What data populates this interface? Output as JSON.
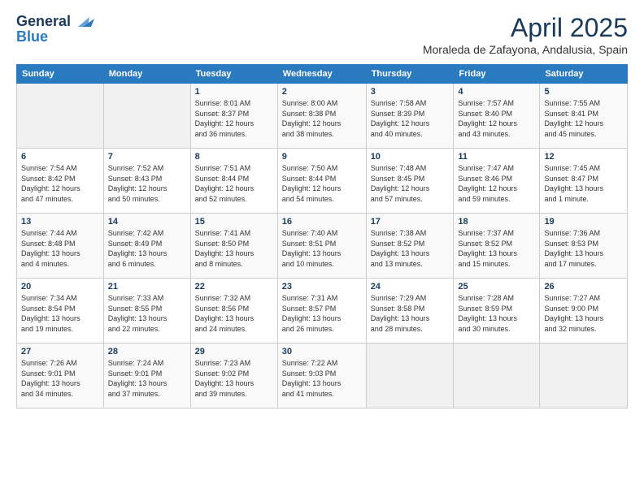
{
  "header": {
    "logo_line1": "General",
    "logo_line2": "Blue",
    "month_title": "April 2025",
    "subtitle": "Moraleda de Zafayona, Andalusia, Spain"
  },
  "days_of_week": [
    "Sunday",
    "Monday",
    "Tuesday",
    "Wednesday",
    "Thursday",
    "Friday",
    "Saturday"
  ],
  "weeks": [
    [
      {
        "num": "",
        "info": ""
      },
      {
        "num": "",
        "info": ""
      },
      {
        "num": "1",
        "info": "Sunrise: 8:01 AM\nSunset: 8:37 PM\nDaylight: 12 hours\nand 36 minutes."
      },
      {
        "num": "2",
        "info": "Sunrise: 8:00 AM\nSunset: 8:38 PM\nDaylight: 12 hours\nand 38 minutes."
      },
      {
        "num": "3",
        "info": "Sunrise: 7:58 AM\nSunset: 8:39 PM\nDaylight: 12 hours\nand 40 minutes."
      },
      {
        "num": "4",
        "info": "Sunrise: 7:57 AM\nSunset: 8:40 PM\nDaylight: 12 hours\nand 43 minutes."
      },
      {
        "num": "5",
        "info": "Sunrise: 7:55 AM\nSunset: 8:41 PM\nDaylight: 12 hours\nand 45 minutes."
      }
    ],
    [
      {
        "num": "6",
        "info": "Sunrise: 7:54 AM\nSunset: 8:42 PM\nDaylight: 12 hours\nand 47 minutes."
      },
      {
        "num": "7",
        "info": "Sunrise: 7:52 AM\nSunset: 8:43 PM\nDaylight: 12 hours\nand 50 minutes."
      },
      {
        "num": "8",
        "info": "Sunrise: 7:51 AM\nSunset: 8:44 PM\nDaylight: 12 hours\nand 52 minutes."
      },
      {
        "num": "9",
        "info": "Sunrise: 7:50 AM\nSunset: 8:44 PM\nDaylight: 12 hours\nand 54 minutes."
      },
      {
        "num": "10",
        "info": "Sunrise: 7:48 AM\nSunset: 8:45 PM\nDaylight: 12 hours\nand 57 minutes."
      },
      {
        "num": "11",
        "info": "Sunrise: 7:47 AM\nSunset: 8:46 PM\nDaylight: 12 hours\nand 59 minutes."
      },
      {
        "num": "12",
        "info": "Sunrise: 7:45 AM\nSunset: 8:47 PM\nDaylight: 13 hours\nand 1 minute."
      }
    ],
    [
      {
        "num": "13",
        "info": "Sunrise: 7:44 AM\nSunset: 8:48 PM\nDaylight: 13 hours\nand 4 minutes."
      },
      {
        "num": "14",
        "info": "Sunrise: 7:42 AM\nSunset: 8:49 PM\nDaylight: 13 hours\nand 6 minutes."
      },
      {
        "num": "15",
        "info": "Sunrise: 7:41 AM\nSunset: 8:50 PM\nDaylight: 13 hours\nand 8 minutes."
      },
      {
        "num": "16",
        "info": "Sunrise: 7:40 AM\nSunset: 8:51 PM\nDaylight: 13 hours\nand 10 minutes."
      },
      {
        "num": "17",
        "info": "Sunrise: 7:38 AM\nSunset: 8:52 PM\nDaylight: 13 hours\nand 13 minutes."
      },
      {
        "num": "18",
        "info": "Sunrise: 7:37 AM\nSunset: 8:52 PM\nDaylight: 13 hours\nand 15 minutes."
      },
      {
        "num": "19",
        "info": "Sunrise: 7:36 AM\nSunset: 8:53 PM\nDaylight: 13 hours\nand 17 minutes."
      }
    ],
    [
      {
        "num": "20",
        "info": "Sunrise: 7:34 AM\nSunset: 8:54 PM\nDaylight: 13 hours\nand 19 minutes."
      },
      {
        "num": "21",
        "info": "Sunrise: 7:33 AM\nSunset: 8:55 PM\nDaylight: 13 hours\nand 22 minutes."
      },
      {
        "num": "22",
        "info": "Sunrise: 7:32 AM\nSunset: 8:56 PM\nDaylight: 13 hours\nand 24 minutes."
      },
      {
        "num": "23",
        "info": "Sunrise: 7:31 AM\nSunset: 8:57 PM\nDaylight: 13 hours\nand 26 minutes."
      },
      {
        "num": "24",
        "info": "Sunrise: 7:29 AM\nSunset: 8:58 PM\nDaylight: 13 hours\nand 28 minutes."
      },
      {
        "num": "25",
        "info": "Sunrise: 7:28 AM\nSunset: 8:59 PM\nDaylight: 13 hours\nand 30 minutes."
      },
      {
        "num": "26",
        "info": "Sunrise: 7:27 AM\nSunset: 9:00 PM\nDaylight: 13 hours\nand 32 minutes."
      }
    ],
    [
      {
        "num": "27",
        "info": "Sunrise: 7:26 AM\nSunset: 9:01 PM\nDaylight: 13 hours\nand 34 minutes."
      },
      {
        "num": "28",
        "info": "Sunrise: 7:24 AM\nSunset: 9:01 PM\nDaylight: 13 hours\nand 37 minutes."
      },
      {
        "num": "29",
        "info": "Sunrise: 7:23 AM\nSunset: 9:02 PM\nDaylight: 13 hours\nand 39 minutes."
      },
      {
        "num": "30",
        "info": "Sunrise: 7:22 AM\nSunset: 9:03 PM\nDaylight: 13 hours\nand 41 minutes."
      },
      {
        "num": "",
        "info": ""
      },
      {
        "num": "",
        "info": ""
      },
      {
        "num": "",
        "info": ""
      }
    ]
  ]
}
